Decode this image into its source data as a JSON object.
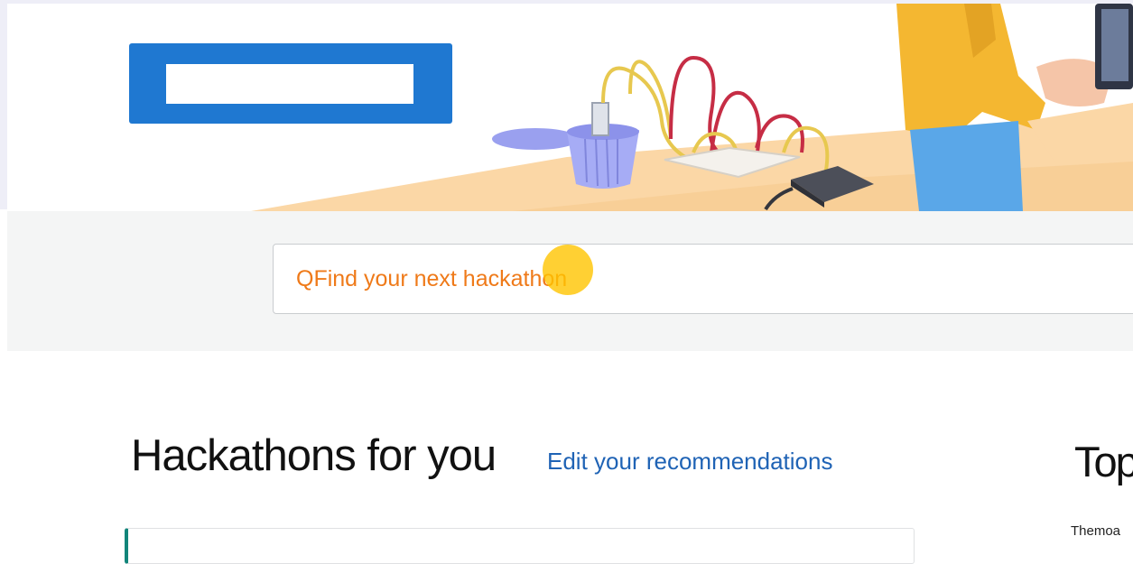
{
  "search": {
    "placeholder": "QFind your next hackathon"
  },
  "section": {
    "title": "Hackathons for you",
    "edit_link": "Edit your recommendations"
  },
  "sidebar": {
    "title": "Top",
    "snippet": "Themoa"
  },
  "colors": {
    "logo_blue": "#1f78d1",
    "search_text": "#ef7a19",
    "link_blue": "#1f63b5",
    "card_accent": "#12857a",
    "band_gray": "#f4f5f5",
    "cursor_highlight": "#ffc400"
  },
  "icons": {
    "hero": "hackathon-workbench-illustration"
  }
}
